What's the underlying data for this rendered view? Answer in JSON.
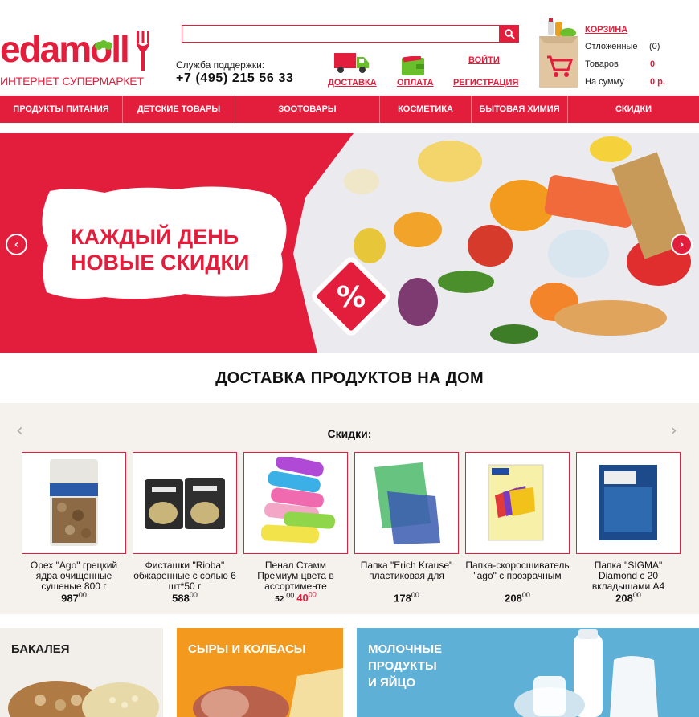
{
  "header": {
    "logo_text_1": "eda",
    "logo_text_2": "moll",
    "logo_subtitle": "ИНТЕРНЕТ СУПЕРМАРКЕТ",
    "search_placeholder": "",
    "support_label": "Служба поддержки:",
    "support_phone": "+7 (495) 215 56 33",
    "delivery_link": "ДОСТАВКА",
    "payment_link": "ОПЛАТА",
    "login_link": "ВОЙТИ",
    "register_link": "РЕГИСТРАЦИЯ",
    "cart": {
      "title": "КОРЗИНА",
      "deferred_label": "Отложенные",
      "deferred_value": "(0)",
      "items_label": "Товаров",
      "items_value": "0",
      "sum_label": "На сумму",
      "sum_value": "0 р."
    }
  },
  "nav": [
    {
      "label": "ПРОДУКТЫ ПИТАНИЯ"
    },
    {
      "label": "ДЕТСКИЕ ТОВАРЫ"
    },
    {
      "label": "ЗООТОВАРЫ"
    },
    {
      "label": "КОСМЕТИКА"
    },
    {
      "label": "БЫТОВАЯ ХИМИЯ"
    },
    {
      "label": "СКИДКИ"
    }
  ],
  "banner": {
    "line1": "КАЖДЫЙ ДЕНЬ",
    "line2": "НОВЫЕ СКИДКИ",
    "badge": "%"
  },
  "delivery_title": "ДОСТАВКА ПРОДУКТОВ НА ДОМ",
  "discounts": {
    "title": "Скидки:",
    "products": [
      {
        "name": "Орех \"Ago\" грецкий ядра очищенные сушеные 800 г",
        "price": "987",
        "kop": "00"
      },
      {
        "name": "Фисташки \"Rioba\" обжаренные с солью 6 шт*50 г",
        "price": "588",
        "kop": "00"
      },
      {
        "name": "Пенал Стамм Премиум цвета в ассортименте",
        "old_price": "52",
        "old_kop": "00",
        "price": "40",
        "kop": "00"
      },
      {
        "name": "Папка \"Erich Krause\" пластиковая для",
        "price": "178",
        "kop": "00"
      },
      {
        "name": "Папка-скоросшиватель \"ago\" с прозрачным",
        "price": "208",
        "kop": "00"
      },
      {
        "name": "Папка \"SIGMA\" Diamond с 20 вкладышами А4",
        "price": "208",
        "kop": "00"
      }
    ]
  },
  "categories": [
    {
      "label": "БАКАЛЕЯ"
    },
    {
      "label": "СЫРЫ И КОЛБАСЫ"
    },
    {
      "label": "МОЛОЧНЫЕ\nПРОДУКТЫ\nИ ЯЙЦО"
    }
  ],
  "colors": {
    "brand_red": "#e31e3c",
    "brand_green": "#6abf2d"
  }
}
